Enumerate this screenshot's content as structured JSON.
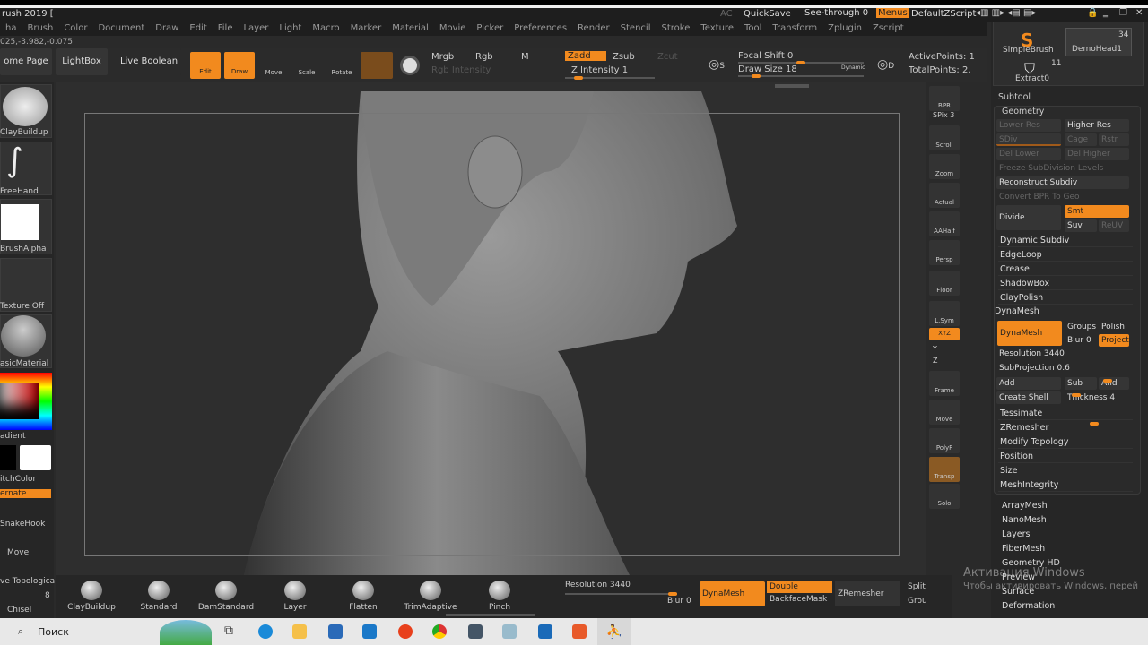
{
  "title": "rush 2019 [",
  "topbar": {
    "ac": "AC",
    "quicksave": "QuickSave",
    "see_through": "See-through  0",
    "menus": "Menus",
    "script": "DefaultZScript"
  },
  "menu": [
    "ha",
    "Brush",
    "Color",
    "Document",
    "Draw",
    "Edit",
    "File",
    "Layer",
    "Light",
    "Macro",
    "Marker",
    "Material",
    "Movie",
    "Picker",
    "Preferences",
    "Render",
    "Stencil",
    "Stroke",
    "Texture",
    "Tool",
    "Transform",
    "Zplugin",
    "Zscript"
  ],
  "coords": "025,-3.982,-0.075",
  "toolbar": {
    "home": "ome Page",
    "lightbox": "LightBox",
    "live_boolean": "Live Boolean",
    "edit": "Edit",
    "draw": "Draw",
    "move": "Move",
    "scale": "Scale",
    "rotate": "Rotate",
    "mrgb": "Mrgb",
    "rgb": "Rgb",
    "m": "M",
    "rgb_intensity": "Rgb Intensity",
    "zadd": "Zadd",
    "zsub": "Zsub",
    "zcut": "Zcut",
    "z_intensity": "Z Intensity 1",
    "focal_shift": "Focal Shift 0",
    "draw_size": "Draw Size 18",
    "dynamic": "Dynamic",
    "active_points": "ActivePoints: 1",
    "total_points": "TotalPoints: 2.",
    "s": "S",
    "d": "D"
  },
  "tool_thumbs": {
    "simplebrush": "SimpleBrush",
    "demohead": "DemoHead1",
    "demohead_count": "34",
    "extract": "Extract0",
    "extract_count": "11"
  },
  "left_shelf": {
    "brush": "ClayBuildup",
    "stroke": "FreeHand",
    "alpha": "BrushAlpha",
    "texture": "Texture Off",
    "material": "asicMaterial",
    "gradient": "adient",
    "switch": "itchColor",
    "alternate": "ernate",
    "brushes": [
      "SnakeHook",
      "Move",
      "ve Topologica",
      "Chisel"
    ],
    "chisel_count": "8"
  },
  "right_shelf": [
    "BPR",
    "SPix 3",
    "Scroll",
    "Zoom",
    "Actual",
    "AAHalf",
    "Persp",
    "Floor",
    "L.Sym",
    "XYZ",
    "Y",
    "Z",
    "Frame",
    "Move",
    "PolyF",
    "Transp",
    "Solo"
  ],
  "panel": {
    "subtool": "Subtool",
    "geometry": "Geometry",
    "lower_res": "Lower Res",
    "higher_res": "Higher Res",
    "sdiv": "SDiv",
    "cage": "Cage",
    "rstr": "Rstr",
    "del_lower": "Del Lower",
    "del_higher": "Del Higher",
    "freeze": "Freeze SubDivision Levels",
    "reconstruct": "Reconstruct Subdiv",
    "convert": "Convert BPR To Geo",
    "divide": "Divide",
    "smt": "Smt",
    "suv": "Suv",
    "reuv": "ReUV",
    "items": [
      "Dynamic Subdiv",
      "EdgeLoop",
      "Crease",
      "ShadowBox",
      "ClayPolish"
    ],
    "dynamesh_header": "DynaMesh",
    "dynamesh": "DynaMesh",
    "groups": "Groups",
    "polish": "Polish",
    "blur": "Blur 0",
    "project": "Project",
    "resolution": "Resolution 3440",
    "subprojection": "SubProjection 0.6",
    "add": "Add",
    "sub": "Sub",
    "and": "And",
    "create_shell": "Create Shell",
    "thickness": "Thickness 4",
    "items2": [
      "Tessimate",
      "ZRemesher",
      "Modify Topology",
      "Position",
      "Size",
      "MeshIntegrity"
    ],
    "sections": [
      "ArrayMesh",
      "NanoMesh",
      "Layers",
      "FiberMesh",
      "Geometry HD",
      "Preview",
      "Surface",
      "Deformation"
    ]
  },
  "bottom": {
    "brushes": [
      "ClayBuildup",
      "Standard",
      "DamStandard",
      "Layer",
      "Flatten",
      "TrimAdaptive",
      "Pinch"
    ],
    "resolution": "Resolution 3440",
    "blur": "Blur 0",
    "dynamesh": "DynaMesh",
    "double": "Double",
    "backface": "BackfaceMask",
    "zremesher": "ZRemesher",
    "split": "Split",
    "group": "Grou"
  },
  "watermark": {
    "line1": "Активация Windows",
    "line2": "Чтобы активировать Windows, перей"
  },
  "taskbar": {
    "search": "Поиск"
  },
  "colors": {
    "accent": "#f28a1e"
  }
}
